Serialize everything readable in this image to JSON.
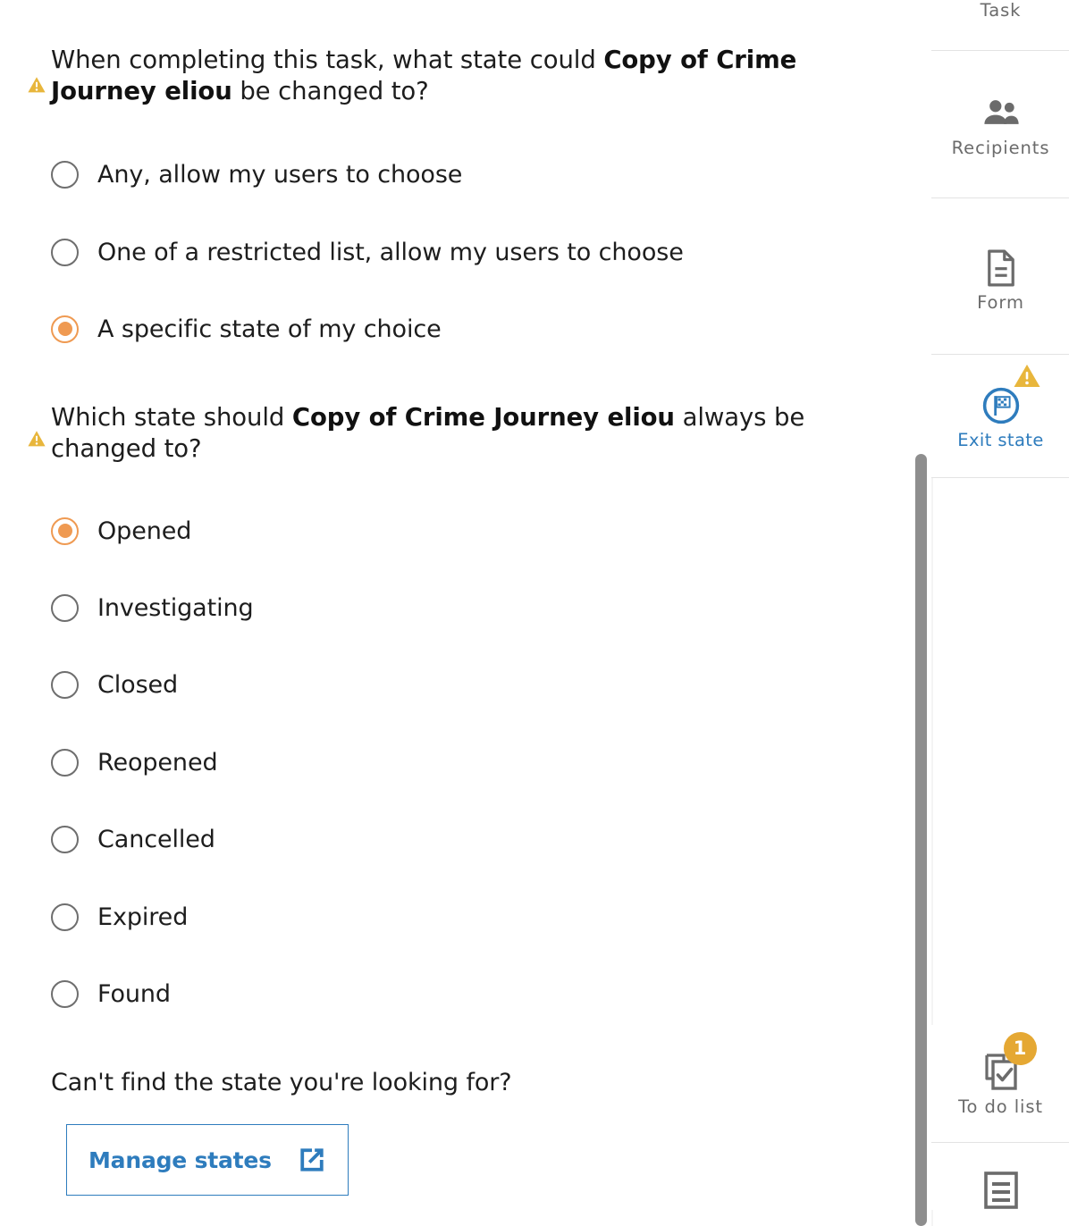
{
  "theme": {
    "accent_orange": "#ef9a52",
    "accent_blue": "#2e7cbd",
    "warning_yellow": "#e8b63c",
    "badge_amber": "#e5a833",
    "top_strip": "#f2e0ad",
    "text": "#1d1d1d",
    "muted_text": "#6b6b6b"
  },
  "main": {
    "questions": [
      {
        "id": "exit-state-mode",
        "warning_icon": "warning-triangle-icon",
        "prefix": "When completing this task, what state could ",
        "emphasis": "Copy of Crime Journey eliou",
        "suffix": " be changed to?",
        "options": [
          {
            "label": "Any, allow my users to choose",
            "selected": false
          },
          {
            "label": "One of a restricted list, allow my users to choose",
            "selected": false
          },
          {
            "label": "A specific state of my choice",
            "selected": true
          }
        ]
      },
      {
        "id": "exit-state-target",
        "warning_icon": "warning-triangle-icon",
        "prefix": "Which state should ",
        "emphasis": "Copy of Crime Journey eliou",
        "suffix": " always be changed to?",
        "options": [
          {
            "label": "Opened",
            "selected": true
          },
          {
            "label": "Investigating",
            "selected": false
          },
          {
            "label": "Closed",
            "selected": false
          },
          {
            "label": "Reopened",
            "selected": false
          },
          {
            "label": "Cancelled",
            "selected": false
          },
          {
            "label": "Expired",
            "selected": false
          },
          {
            "label": "Found",
            "selected": false
          }
        ]
      }
    ],
    "helper_text": "Can't find the state you're looking for?",
    "manage_button": {
      "label": "Manage states",
      "icon": "external-link-icon"
    }
  },
  "rail": {
    "items": [
      {
        "label": "Task",
        "icon": "task-icon",
        "active": false,
        "badge": null
      },
      {
        "label": "Recipients",
        "icon": "people-icon",
        "active": false,
        "badge": null
      },
      {
        "label": "Form",
        "icon": "document-icon",
        "active": false,
        "badge": null
      },
      {
        "label": "Exit state",
        "icon": "checkered-flag-icon",
        "active": true,
        "badge": "warning"
      },
      {
        "label": "To do list",
        "icon": "checklist-icon",
        "active": false,
        "badge": "1"
      },
      {
        "label": "",
        "icon": "notes-icon",
        "active": false,
        "badge": null
      }
    ]
  }
}
